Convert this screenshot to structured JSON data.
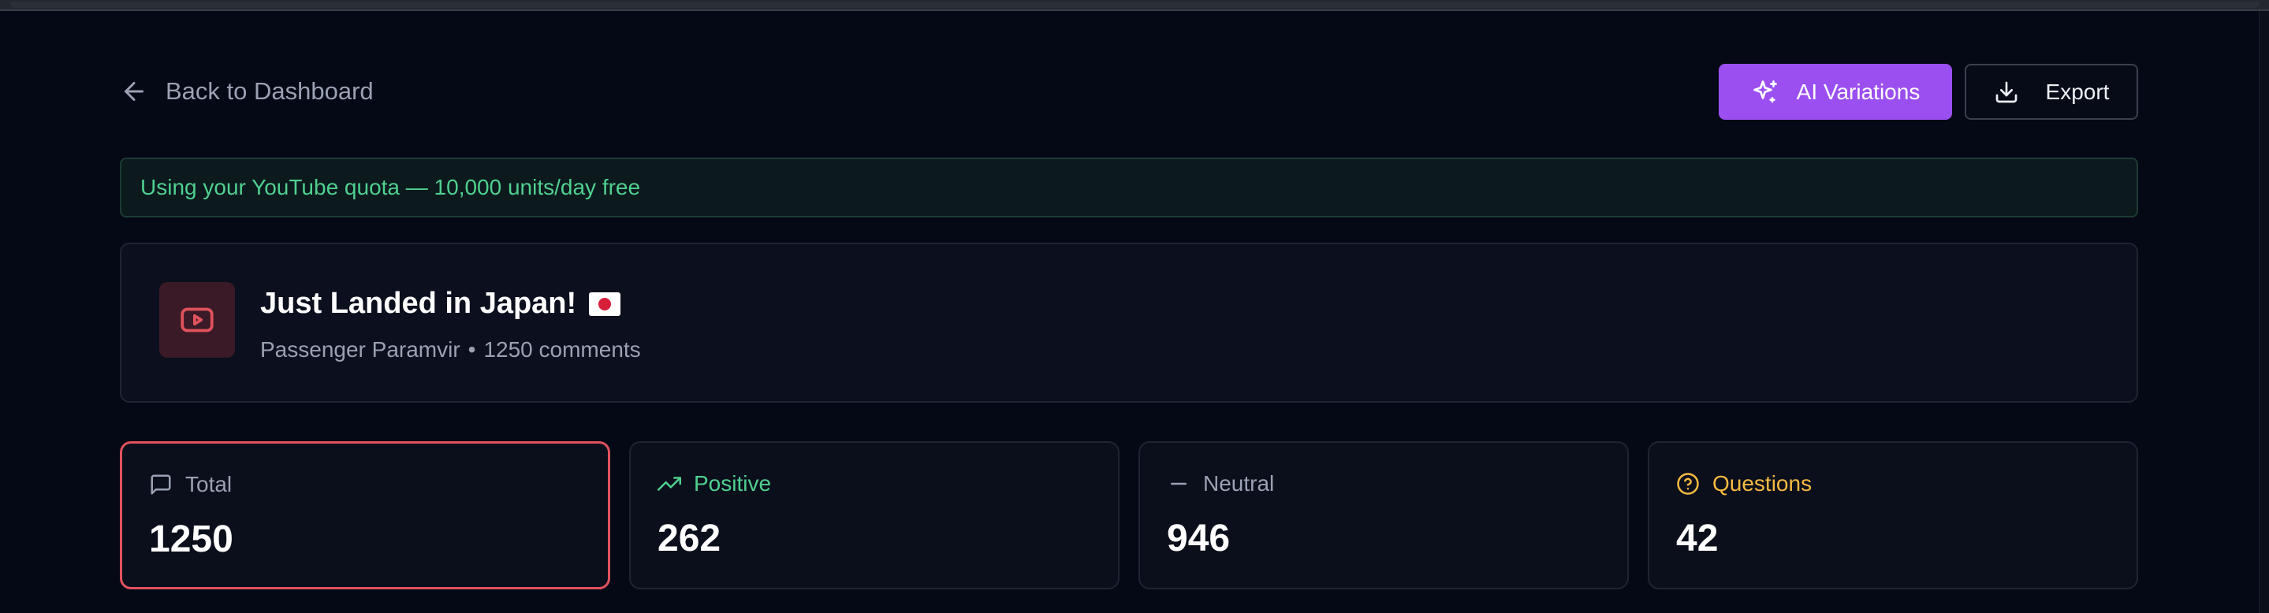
{
  "header": {
    "back_label": "Back to Dashboard",
    "ai_variations_label": "AI Variations",
    "export_label": "Export"
  },
  "quota_banner": {
    "text": "Using your YouTube quota — 10,000 units/day free"
  },
  "video": {
    "title": "Just Landed in Japan!",
    "flag_icon": "japan-flag-icon",
    "channel": "Passenger Paramvir",
    "separator": "•",
    "comments": "1250 comments"
  },
  "stats": [
    {
      "label": "Total",
      "value": "1250",
      "icon": "message-square-icon",
      "color": "#9aa1b2",
      "selected": true
    },
    {
      "label": "Positive",
      "value": "262",
      "icon": "trending-up-icon",
      "color": "#4fd08e",
      "selected": false
    },
    {
      "label": "Neutral",
      "value": "946",
      "icon": "minus-icon",
      "color": "#9aa1b2",
      "selected": false
    },
    {
      "label": "Questions",
      "value": "42",
      "icon": "help-circle-icon",
      "color": "#f5b940",
      "selected": false
    }
  ],
  "colors": {
    "background": "#050815",
    "accent_purple": "#9b4ff0",
    "positive_green": "#4fd08e",
    "question_amber": "#f5b940",
    "selected_border": "#e0525d",
    "youtube_red": "#e0525d"
  }
}
